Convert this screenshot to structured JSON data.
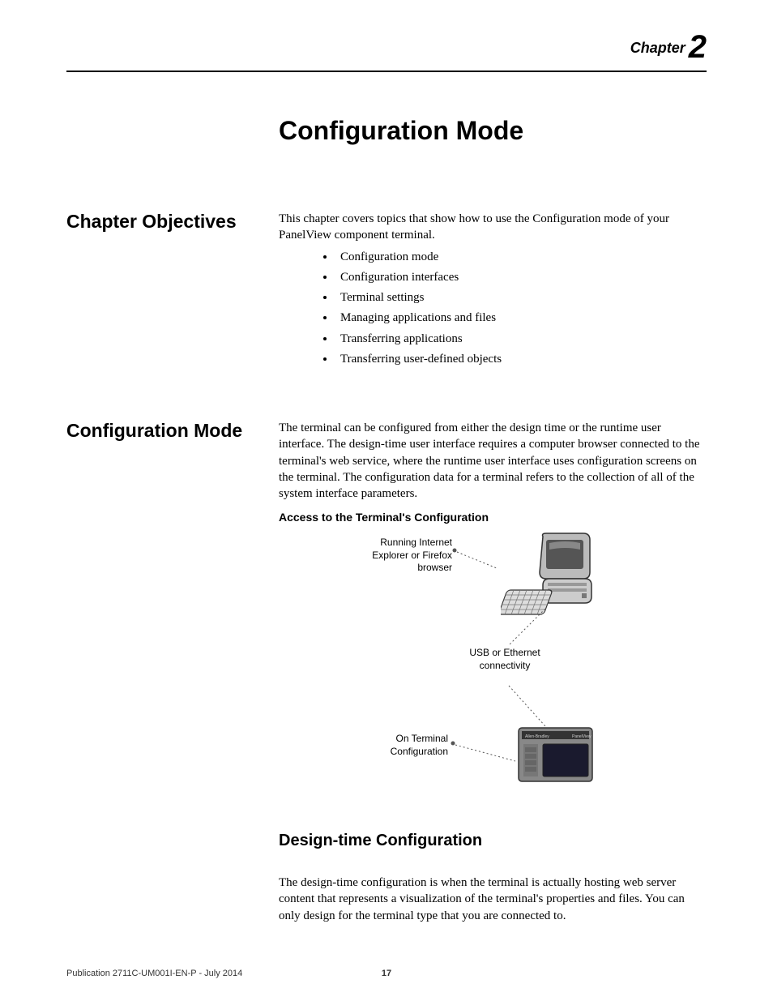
{
  "header": {
    "chapter_word": "Chapter",
    "chapter_num": "2"
  },
  "title": "Configuration Mode",
  "sections": {
    "objectives": {
      "heading": "Chapter Objectives",
      "intro": "This chapter covers topics that show how to use the Configuration mode of your PanelView component terminal.",
      "items": [
        "Configuration mode",
        "Configuration interfaces",
        "Terminal settings",
        "Managing applications and files",
        "Transferring applications",
        "Transferring user-defined objects"
      ]
    },
    "config_mode": {
      "heading": "Configuration Mode",
      "para": "The terminal can be configured from either the design time or the runtime user interface. The design-time user interface requires a computer browser connected to the terminal's web service, where the runtime user interface uses configuration screens on the terminal. The configuration data for a terminal refers to the collection of all of the system interface parameters.",
      "diagram_title": "Access to the Terminal's Configuration",
      "diagram": {
        "label_top": "Running Internet Explorer or Firefox browser",
        "label_mid": "USB or Ethernet connectivity",
        "label_bot": "On Terminal Configuration"
      }
    },
    "design_time": {
      "heading": "Design-time Configuration",
      "para": "The design-time configuration is when the terminal is actually hosting web server content that represents a visualization of the terminal's properties and files. You can only design for the terminal type that you are connected to."
    }
  },
  "footer": {
    "pub": "Publication 2711C-UM001I-EN-P - July 2014",
    "page": "17"
  }
}
